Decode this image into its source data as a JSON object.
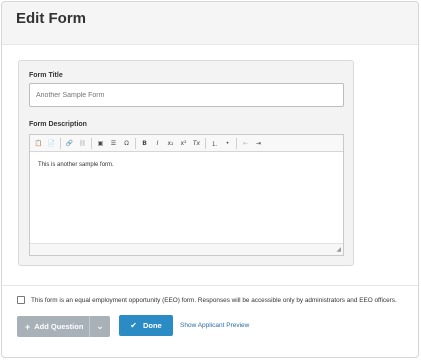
{
  "modal": {
    "title": "Edit Form"
  },
  "form": {
    "title_label": "Form Title",
    "title_placeholder": "Another Sample Form",
    "description_label": "Form Description",
    "description_text": "This is another sample form."
  },
  "toolbar": {
    "icons": [
      "paste-icon",
      "paste-text-icon",
      "link-icon",
      "unlink-icon",
      "image-icon",
      "horizontal-rule-icon",
      "special-char-icon",
      "bold-icon",
      "italic-icon",
      "subscript-icon",
      "superscript-icon",
      "remove-format-icon",
      "numbered-list-icon",
      "bulleted-list-icon",
      "outdent-icon",
      "indent-icon"
    ],
    "bold": "B",
    "italic": "I",
    "subscript": "x₂",
    "superscript": "x²",
    "remove_format": "Tx"
  },
  "eeo": {
    "label": "This form is an equal employment opportunity (EEO) form. Responses will be accessible only by administrators and EEO officers.",
    "checked": false
  },
  "actions": {
    "add_question": "Add Question",
    "done": "Done",
    "preview": "Show Applicant Preview"
  },
  "colors": {
    "primary": "#2b8bc5",
    "secondary_button": "#a8b0b8",
    "link": "#2a6ea5"
  }
}
